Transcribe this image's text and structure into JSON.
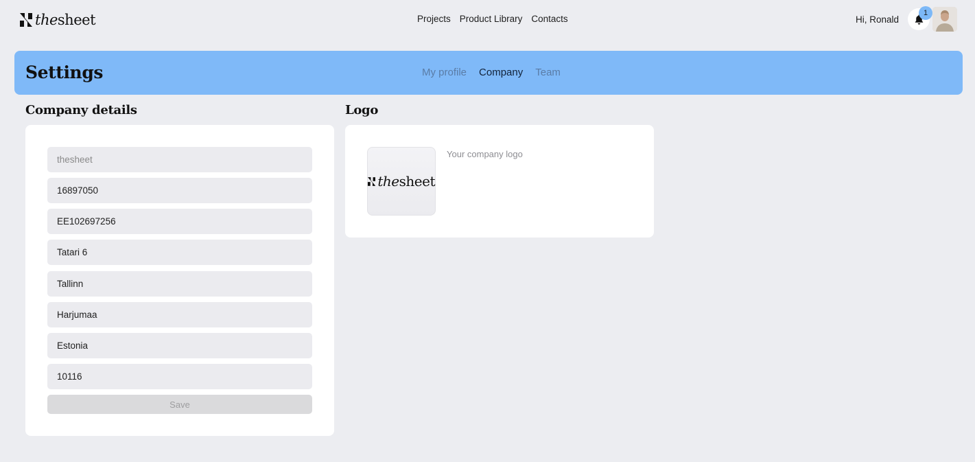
{
  "header": {
    "brand": {
      "part1": "the",
      "part2": "sheet"
    },
    "nav": [
      "Projects",
      "Product Library",
      "Contacts"
    ],
    "greeting": "Hi, Ronald",
    "notification_count": "1",
    "icons": {
      "notifications": "bell-icon",
      "avatar": "user-avatar"
    }
  },
  "settings": {
    "title": "Settings",
    "tabs": [
      {
        "label": "My profile",
        "active": false
      },
      {
        "label": "Company",
        "active": true
      },
      {
        "label": "Team",
        "active": false
      }
    ]
  },
  "company_details": {
    "title": "Company details",
    "fields": [
      {
        "name": "company-name-field",
        "value": "",
        "placeholder": "thesheet"
      },
      {
        "name": "registration-code-field",
        "value": "16897050",
        "placeholder": ""
      },
      {
        "name": "vat-number-field",
        "value": "EE102697256",
        "placeholder": ""
      },
      {
        "name": "street-address-field",
        "value": "Tatari 6",
        "placeholder": ""
      },
      {
        "name": "city-field",
        "value": "Tallinn",
        "placeholder": ""
      },
      {
        "name": "county-field",
        "value": "Harjumaa",
        "placeholder": ""
      },
      {
        "name": "country-field",
        "value": "Estonia",
        "placeholder": ""
      },
      {
        "name": "postal-code-field",
        "value": "10116",
        "placeholder": ""
      }
    ],
    "save_label": "Save"
  },
  "logo": {
    "title": "Logo",
    "caption": "Your company logo",
    "brand": {
      "part1": "the",
      "part2": "sheet"
    }
  },
  "colors": {
    "background": "#ecedf1",
    "banner": "#7fb9f8",
    "badge": "#7cb8f7",
    "card": "#ffffff",
    "field": "#ebebef",
    "save_disabled": "#dadadc"
  }
}
